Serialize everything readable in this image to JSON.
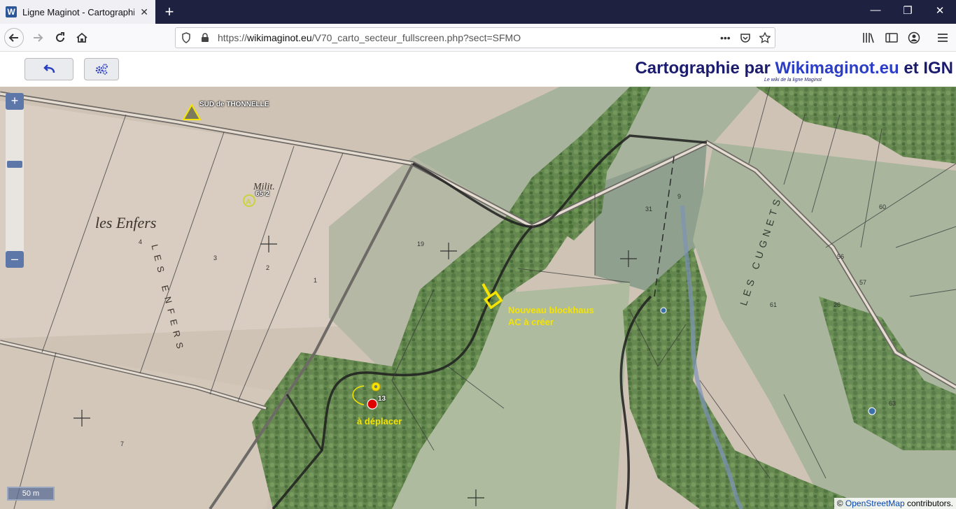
{
  "browser": {
    "tab_icon_letter": "W",
    "tab_title": "Ligne Maginot - Cartographie c",
    "url_prefix": "https://",
    "url_domain": "wikimaginot.eu",
    "url_path": "/V70_carto_secteur_fullscreen.php?sect=SFMO",
    "url_more": "•••"
  },
  "header": {
    "brand_prefix": "Cartographie par ",
    "brand_name": "Wikimaginot.eu",
    "brand_suffix": " et IGN",
    "brand_tagline": "Le wiki de la ligne Maginot"
  },
  "map": {
    "zoom_in": "+",
    "zoom_out": "–",
    "scale_label": "50 m",
    "attribution_prefix": "© ",
    "attribution_link": "OpenStreetMap",
    "attribution_suffix": " contributors.",
    "place_labels": {
      "les_enfers": "les Enfers",
      "les_enfers_vertical": "LES ENFERS",
      "les_cugnets": "LES CUGNETS",
      "milit": "Milit."
    },
    "markers": {
      "sud_thonnelle": "SUD de THONNELLE",
      "ouvrage_652": "65-2",
      "ouvrage_13": "13"
    },
    "annotations": {
      "new_blockhaus_line1": "Nouveau blockhaus",
      "new_blockhaus_line2": "AC à créer",
      "a_deplacer": "à déplacer"
    },
    "colors": {
      "annotation": "#f5e400",
      "marker_red": "#e00000",
      "zoom_button": "#5d78a8"
    }
  }
}
